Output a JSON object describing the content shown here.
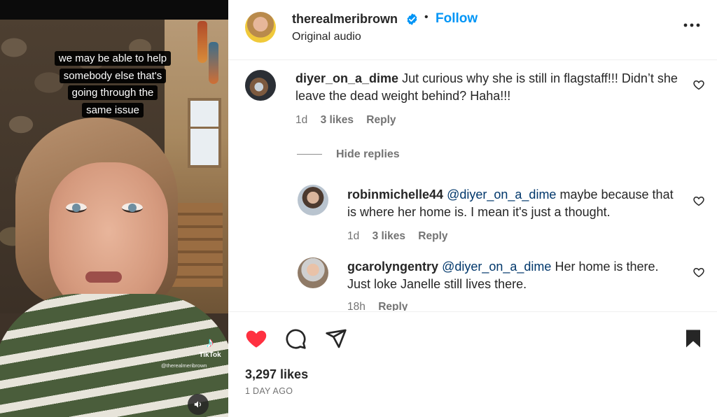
{
  "media": {
    "caption_lines": [
      "we may be able to help",
      "somebody else that's",
      "going through the",
      "same issue"
    ],
    "watermark": {
      "brand": "TikTok",
      "handle": "@therealmeribrown"
    },
    "sound_icon": "speaker-icon"
  },
  "post_header": {
    "username": "therealmeribrown",
    "verified": true,
    "separator": "•",
    "follow_label": "Follow",
    "subtitle": "Original audio",
    "more_icon": "more-options-icon"
  },
  "comments": [
    {
      "username": "diyer_on_a_dime",
      "mention": "",
      "text": "Jut curious why she is still in flagstaff!!! Didn’t she leave the dead weight behind? Haha!!!",
      "age": "1d",
      "likes": "3 likes",
      "reply_label": "Reply"
    }
  ],
  "hide_replies_label": "Hide replies",
  "replies": [
    {
      "username": "robinmichelle44",
      "mention": "@diyer_on_a_dime",
      "text": "maybe because that is where her home is. I mean it's just a thought.",
      "age": "1d",
      "likes": "3 likes",
      "reply_label": "Reply"
    },
    {
      "username": "gcarolyngentry",
      "mention": "@diyer_on_a_dime",
      "text": "Her home is there. Just loke Janelle still lives there.",
      "age": "18h",
      "likes": "",
      "reply_label": "Reply"
    }
  ],
  "actions": {
    "liked": true,
    "like_color": "#ff3040",
    "likes_count": "3,297 likes",
    "time_ago": "1 DAY AGO"
  },
  "colors": {
    "accent": "#0095f6",
    "text": "#262626",
    "muted": "#737373",
    "mention": "#00376b"
  }
}
